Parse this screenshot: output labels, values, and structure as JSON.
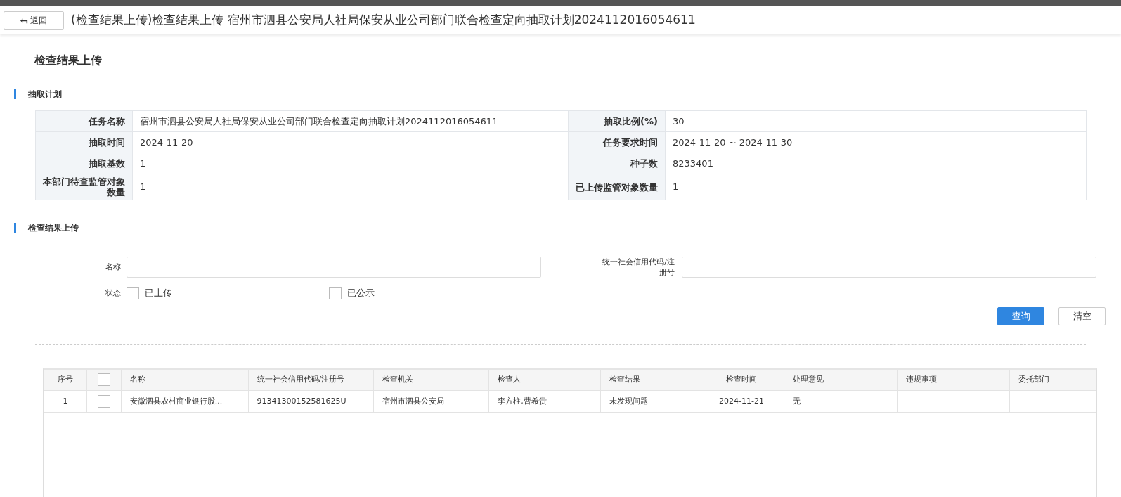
{
  "header": {
    "back_button": {
      "icon": "⮢",
      "label": "返回"
    },
    "title": "(检查结果上传)检查结果上传 宿州市泗县公安局人社局保安从业公司部门联合检查定向抽取计划2024112016054611"
  },
  "page_title": "检查结果上传",
  "plan_section": {
    "title": "抽取计划",
    "rows": [
      [
        {
          "label": "任务名称",
          "value": "宿州市泗县公安局人社局保安从业公司部门联合检查定向抽取计划2024112016054611"
        },
        {
          "label": "抽取比例(%)",
          "value": "30"
        }
      ],
      [
        {
          "label": "抽取时间",
          "value": "2024-11-20"
        },
        {
          "label": "任务要求时间",
          "value": "2024-11-20 ~ 2024-11-30"
        }
      ],
      [
        {
          "label": "抽取基数",
          "value": "1"
        },
        {
          "label": "种子数",
          "value": "8233401"
        }
      ],
      [
        {
          "label": "本部门待查监管对象数量",
          "value": "1"
        },
        {
          "label": "已上传监管对象数量",
          "value": "1"
        }
      ]
    ]
  },
  "upload_section": {
    "title": "检查结果上传",
    "name_field": {
      "label": "名称"
    },
    "code_field": {
      "label": "统一社会信用代码/注册号"
    },
    "status": {
      "label": "状态",
      "options": [
        {
          "label": "已上传",
          "checked": false
        },
        {
          "label": "已公示",
          "checked": false
        }
      ]
    },
    "buttons": [
      {
        "label": "查询",
        "kind": "primary"
      },
      {
        "label": "清空",
        "kind": "default"
      }
    ]
  },
  "table": {
    "columns": [
      {
        "kind": "text",
        "label": "序号"
      },
      {
        "kind": "checkbox",
        "checked": false
      },
      {
        "kind": "text",
        "label": "名称"
      },
      {
        "kind": "text",
        "label": "统一社会信用代码/注册号"
      },
      {
        "kind": "text",
        "label": "检查机关"
      },
      {
        "kind": "text",
        "label": "检查人"
      },
      {
        "kind": "text",
        "label": "检查结果"
      },
      {
        "kind": "text",
        "label": "检查时间"
      },
      {
        "kind": "text",
        "label": "处理意见"
      },
      {
        "kind": "text",
        "label": "违规事项"
      },
      {
        "kind": "text",
        "label": "委托部门"
      }
    ],
    "rows": [
      {
        "checked": false,
        "cells": [
          "1",
          "",
          "安徽泗县农村商业银行股...",
          "91341300152581625U",
          "宿州市泗县公安局",
          "李方柱,曹希贵",
          "未发现问题",
          "2024-11-21",
          "无",
          "",
          ""
        ]
      }
    ]
  }
}
